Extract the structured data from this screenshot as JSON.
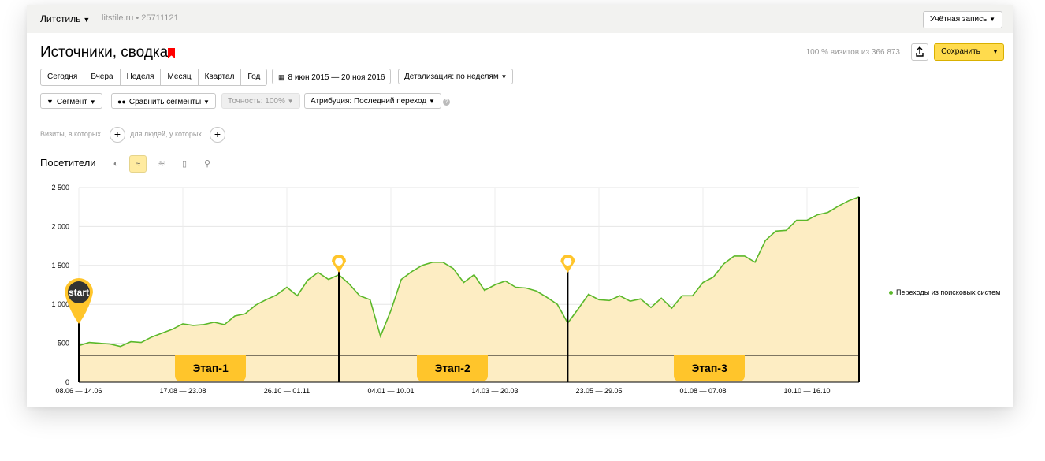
{
  "topbar": {
    "counter_name": "Литстиль",
    "site": "litstile.ru  •  25711121",
    "account_label": "Учётная запись"
  },
  "header": {
    "title": "Источники, сводка",
    "visits_note": "100 % визитов из 366 873",
    "save_label": "Сохранить"
  },
  "periods": [
    "Сегодня",
    "Вчера",
    "Неделя",
    "Месяц",
    "Квартал",
    "Год"
  ],
  "date_range": "8 июн 2015 — 20 ноя 2016",
  "detail": "Детализация: по неделям",
  "segment_label": "Сегмент",
  "compare_label": "Сравнить сегменты",
  "accuracy_label": "Точность: 100%",
  "attribution_label": "Атрибуция: Последний переход",
  "conditions": {
    "visits_text": "Визиты, в которых",
    "people_text": "для людей, у которых"
  },
  "chart_title": "Посетители",
  "view_icons": [
    "pie-chart-icon",
    "line-chart-icon",
    "area-chart-icon",
    "bar-chart-icon",
    "map-icon"
  ],
  "legend_label": "Переходы из поисковых систем",
  "colors": {
    "line": "#5bb82a",
    "fill": "#fdedc3",
    "accent": "#ffc52b",
    "save": "#ffdb4d"
  },
  "chart_data": {
    "type": "area",
    "title": "",
    "xlabel": "",
    "ylabel": "",
    "ylim": [
      0,
      2500
    ],
    "y_ticks": [
      "0",
      "500",
      "1 000",
      "1 500",
      "2 000",
      "2 500"
    ],
    "x_tick_labels": [
      "08.06 — 14.06",
      "17.08 — 23.08",
      "26.10 — 01.11",
      "04.01 — 10.01",
      "14.03 — 20.03",
      "23.05 — 29.05",
      "01.08 — 07.08",
      "10.10 — 16.10"
    ],
    "grid": true,
    "legend_position": "right",
    "series": [
      {
        "name": "Переходы из поисковых систем",
        "week_index": [
          0,
          1,
          2,
          3,
          4,
          5,
          6,
          7,
          8,
          9,
          10,
          11,
          12,
          13,
          14,
          15,
          16,
          17,
          18,
          19,
          20,
          21,
          22,
          23,
          24,
          25,
          26,
          27,
          28,
          29,
          30,
          31,
          32,
          33,
          34,
          35,
          36,
          37,
          38,
          39,
          40,
          41,
          42,
          43,
          44,
          45,
          46,
          47,
          48,
          49,
          50,
          51,
          52,
          53,
          54,
          55,
          56,
          57,
          58,
          59,
          60,
          61,
          62,
          63,
          64,
          65,
          66,
          67,
          68,
          69,
          70,
          71,
          72,
          73,
          74,
          75
        ],
        "values": [
          470,
          510,
          500,
          490,
          460,
          520,
          510,
          580,
          630,
          680,
          750,
          730,
          740,
          770,
          740,
          850,
          880,
          990,
          1060,
          1120,
          1220,
          1110,
          1310,
          1410,
          1320,
          1380,
          1260,
          1110,
          1060,
          590,
          920,
          1320,
          1420,
          1500,
          1540,
          1540,
          1460,
          1280,
          1380,
          1180,
          1250,
          1300,
          1220,
          1210,
          1170,
          1090,
          1000,
          760,
          940,
          1130,
          1060,
          1050,
          1110,
          1040,
          1070,
          960,
          1080,
          950,
          1110,
          1110,
          1280,
          1350,
          1520,
          1620,
          1620,
          1540,
          1820,
          1940,
          1950,
          2080,
          2080,
          2150,
          2180,
          2260,
          2330,
          2380
        ]
      }
    ],
    "annotations": [
      {
        "label": "start",
        "week_index": 0
      },
      {
        "label": "",
        "week_index": 25
      },
      {
        "label": "",
        "week_index": 47
      }
    ],
    "stages": [
      "Этап-1",
      "Этап-2",
      "Этап-3"
    ]
  }
}
